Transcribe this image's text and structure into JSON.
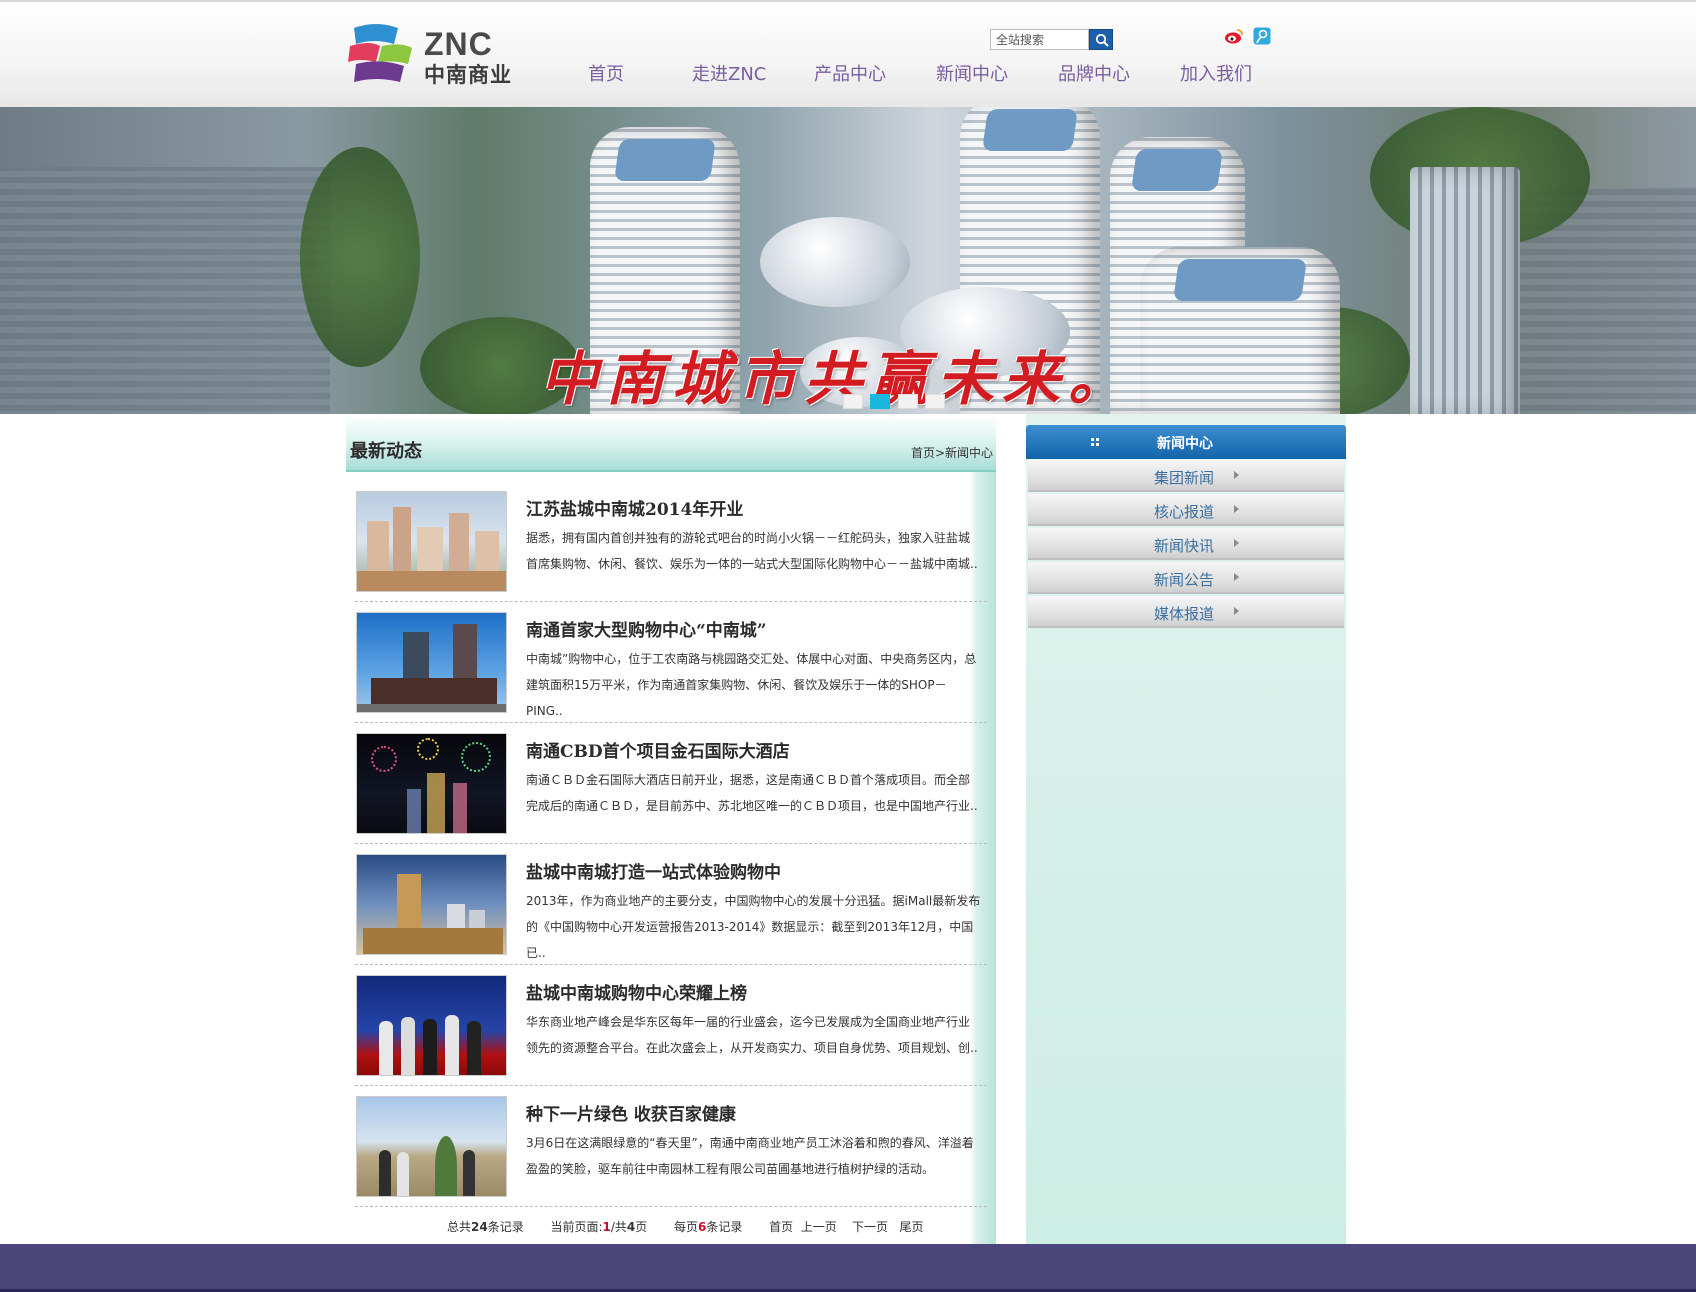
{
  "header": {
    "logo_latin": "ZNC",
    "logo_cn": "中南商业",
    "search_placeholder": "全站搜索",
    "nav": [
      "首页",
      "走进ZNC",
      "产品中心",
      "新闻中心",
      "品牌中心",
      "加入我们"
    ]
  },
  "banner": {
    "slogan": "中南城市共赢未来。",
    "active_slide": 2,
    "slide_count": 4
  },
  "main": {
    "section_title": "最新动态",
    "breadcrumb": "首页>新闻中心",
    "news": [
      {
        "title": "江苏盐城中南城2014年开业",
        "desc": "据悉，拥有国内首创并独有的游轮式吧台的时尚小火锅－－红舵码头，独家入驻盐城首席集购物、休闲、餐饮、娱乐为一体的一站式大型国际化购物中心－－盐城中南城.."
      },
      {
        "title": "南通首家大型购物中心“中南城”",
        "desc": "中南城”购物中心，位于工农南路与桃园路交汇处、体展中心对面、中央商务区内，总建筑面积15万平米，作为南通首家集购物、休闲、餐饮及娱乐于一体的SHOP－PING.."
      },
      {
        "title": "南通CBD首个项目金石国际大酒店",
        "desc": "南通ＣＢＤ金石国际大酒店日前开业，据悉，这是南通ＣＢＤ首个落成项目。而全部完成后的南通ＣＢＤ，是目前苏中、苏北地区唯一的ＣＢＤ项目，也是中国地产行业.."
      },
      {
        "title": "盐城中南城打造一站式体验购物中",
        "desc": "2013年，作为商业地产的主要分支，中国购物中心的发展十分迅猛。据iMall最新发布的《中国购物中心开发运营报告2013-2014》数据显示：截至到2013年12月，中国已.."
      },
      {
        "title": "盐城中南城购物中心荣耀上榜",
        "desc": "华东商业地产峰会是华东区每年一届的行业盛会，迄今已发展成为全国商业地产行业领先的资源整合平台。在此次盛会上，从开发商实力、项目自身优势、项目规划、创.."
      },
      {
        "title": "种下一片绿色 收获百家健康",
        "desc": "3月6日在这满眼绿意的“春天里”，南通中南商业地产员工沐浴着和煦的春风、洋溢着盈盈的笑脸，驱车前往中南园林工程有限公司苗圃基地进行植树护绿的活动。"
      }
    ],
    "pager": {
      "total_prefix": "总共",
      "total": "24",
      "total_suffix": "条记录",
      "current_prefix": "当前页面:",
      "current": "1",
      "pages_prefix": "/共",
      "pages": "4",
      "pages_suffix": "页",
      "per_prefix": "每页",
      "per": "6",
      "per_suffix": "条记录",
      "first": "首页",
      "prev": "上一页",
      "next": "下一页",
      "last": "尾页"
    }
  },
  "sidebar": {
    "title": "新闻中心",
    "items": [
      "集团新闻",
      "核心报道",
      "新闻快讯",
      "新闻公告",
      "媒体报道"
    ]
  },
  "colors": {
    "nav_text": "#7a5e9e",
    "sidebar_head": "#1363a8",
    "sidebar_item_text": "#3a6fa0",
    "footer": "#4b4679",
    "accent_red": "#c8102e",
    "search_button": "#1a5fa8"
  },
  "icons": [
    "search-icon",
    "weibo-icon",
    "tencent-weibo-icon",
    "grip-icon",
    "chevron-right-icon"
  ]
}
